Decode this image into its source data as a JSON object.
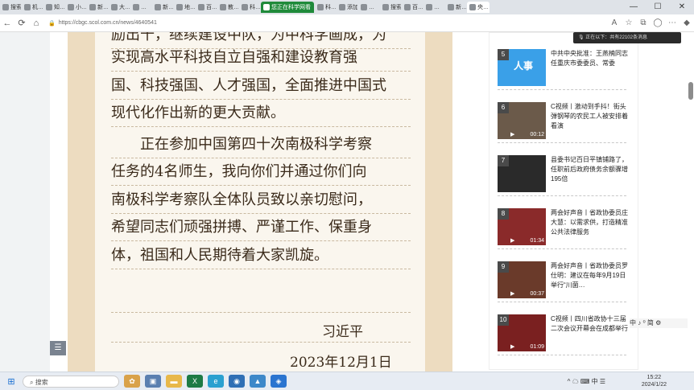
{
  "browser": {
    "tabs": [
      "搜索",
      "机…",
      "知…",
      "小…",
      "新…",
      "大…",
      "…",
      "新…",
      "地…",
      "百…",
      "教…",
      "科…",
      "您正在科学网看",
      "科…",
      "添加…",
      "…",
      "搜索…",
      "百…",
      "…",
      "新…",
      "央…"
    ],
    "green_tab_label": "您正在科学网看",
    "url": "https://cbgc.scol.com.cn/news/4640541",
    "notice_text": "正在以下：共有22102条消息",
    "window_controls": [
      "—",
      "☐",
      "✕"
    ]
  },
  "letter": {
    "lines": [
      "励出十，继续建设中队，为中科学画成，为",
      "实现高水平科技自立自强和建设教育强",
      "国、科技强国、人才强国，全面推进中国式",
      "现代化作出新的更大贡献。",
      "　　正在参加中国第四十次南极科学考察",
      "任务的4名师生，我向你们并通过你们向",
      "南极科学考察队全体队员致以亲切慰问，",
      "希望同志们顽强拼搏、严谨工作、保重身",
      "体，祖国和人民期待着大家凯旋。"
    ],
    "signature": "习近平",
    "date": "2023年12月1日"
  },
  "sidebar": {
    "items": [
      {
        "num": "5",
        "text": "中共中央批准：王燕楠同志任重庆市委委员、常委",
        "duration": "",
        "thumb_label": "人事",
        "thumb_color": "#3aa0e8"
      },
      {
        "num": "6",
        "text": "C视频丨激动到手抖！街头弹钢琴的农民工人被安排着看演",
        "duration": "00:12",
        "thumb_label": "",
        "thumb_color": "#6b5a4a"
      },
      {
        "num": "7",
        "text": "县委书记百日平镇铺路了，任职前后政府债务余额骤增195倍",
        "duration": "",
        "thumb_label": "",
        "thumb_color": "#2a2a2a"
      },
      {
        "num": "8",
        "text": "两会好声音丨省政协委员庄大慧：以需求供，打造精准公共法律服务",
        "duration": "01:34",
        "thumb_label": "",
        "thumb_color": "#8a2a2a"
      },
      {
        "num": "9",
        "text": "两会好声音丨省政协委员罗仕明：建议在每年9月19日举行“川菌…",
        "duration": "00:37",
        "thumb_label": "",
        "thumb_color": "#6a3a2a"
      },
      {
        "num": "10",
        "text": "C视频丨四川省政协十三届二次会议开幕会在成都举行",
        "duration": "01:09",
        "thumb_label": "",
        "thumb_color": "#7a2020"
      }
    ]
  },
  "ime_text": "中 ♪ ⁰ 简 ⚙",
  "taskbar": {
    "search_placeholder": "搜索",
    "time": "15:22",
    "date": "2024/1/22",
    "tray_icons": "^ ☁ ⌨ 中 ☰"
  }
}
